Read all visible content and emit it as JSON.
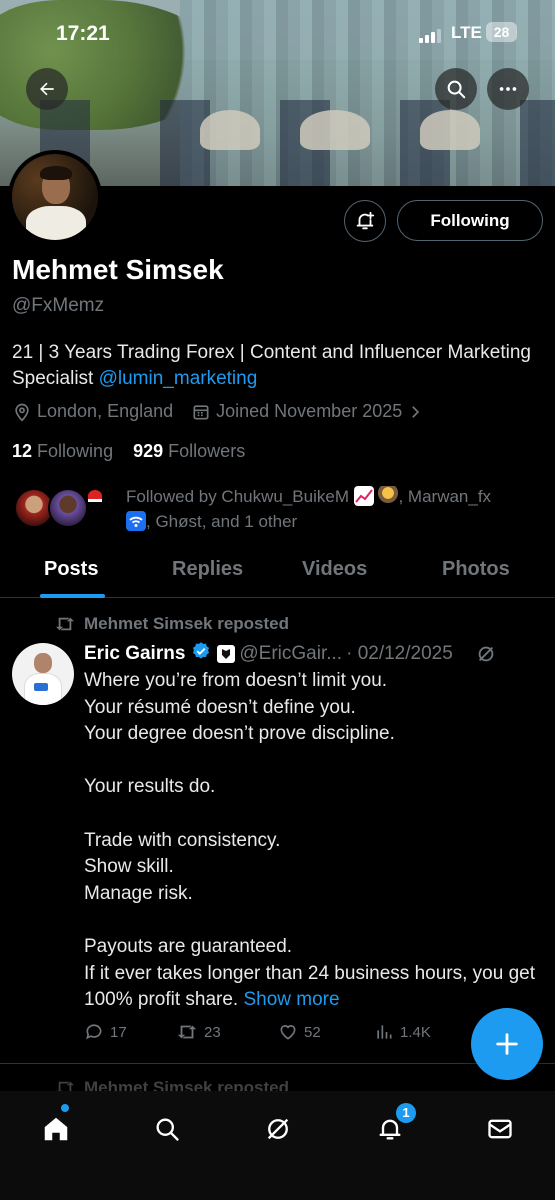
{
  "status_bar": {
    "time": "17:21",
    "network": "LTE",
    "battery": "28"
  },
  "header": {
    "back_icon": "arrow-left-icon",
    "search_icon": "search-icon",
    "more_icon": "more-horizontal-icon"
  },
  "profile": {
    "name": "Mehmet Simsek",
    "handle": "@FxMemz",
    "bio_text": "21 | 3 Years Trading Forex | Content and Influencer Marketing Specialist ",
    "bio_mention": "@lumin_marketing",
    "location": "London, England",
    "joined": "Joined November 2025",
    "following_count": "12",
    "following_label": "Following",
    "followers_count": "929",
    "followers_label": "Followers",
    "follow_button": "Following",
    "followed_by_prefix": "Followed by Chukwu_BuikeM",
    "followed_by_mid": ", Marwan_fx",
    "followed_by_suffix": ", Ghøst, and 1 other"
  },
  "tabs": [
    "Posts",
    "Replies",
    "Videos",
    "Photos"
  ],
  "post": {
    "repost_label": "Mehmet Simsek reposted",
    "author_name": "Eric Gairns",
    "author_handle": "@EricGair...",
    "date": "· 02/12/2025",
    "lines": [
      "Where you’re from doesn’t limit you.",
      "Your résumé doesn’t define you.",
      "Your degree doesn’t prove discipline.",
      "",
      "Your results do.",
      "",
      "Trade with consistency.",
      "Show skill.",
      "Manage risk.",
      "",
      "Payouts are guaranteed.",
      "If it ever takes longer than 24 business hours, you get 100% profit share. "
    ],
    "show_more": "Show more",
    "replies": "17",
    "reposts": "23",
    "likes": "52",
    "views": "1.4K"
  },
  "next_post": {
    "repost_label": "Mehmet Simsek reposted"
  },
  "bottom_nav": {
    "notifications_badge": "1"
  },
  "colors": {
    "accent": "#1d9bf0",
    "muted": "#71767b",
    "background": "#000000"
  }
}
